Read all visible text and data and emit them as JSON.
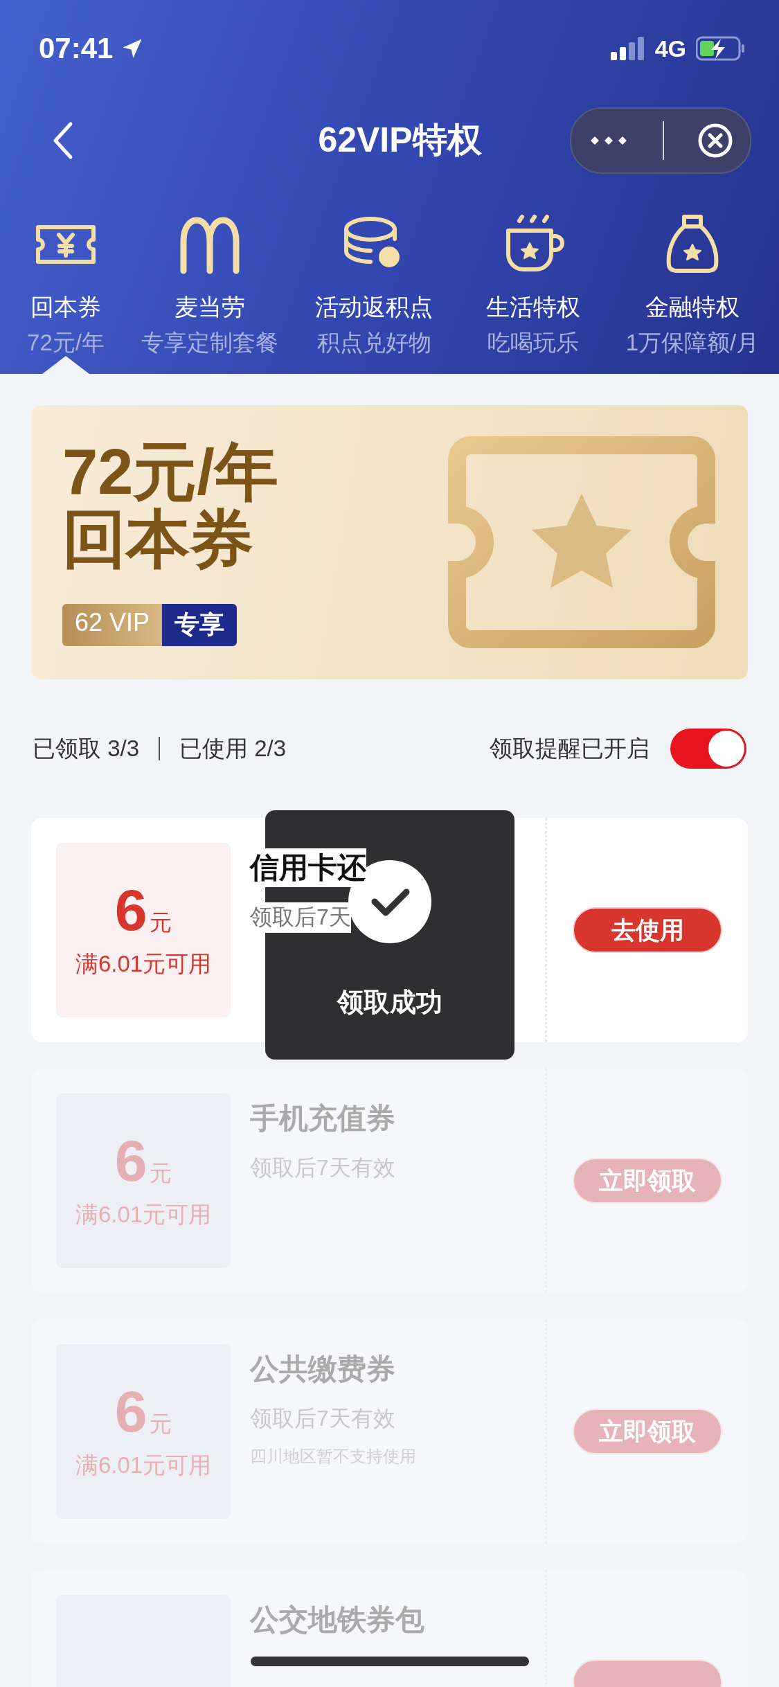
{
  "status_bar": {
    "time": "07:41",
    "network": "4G"
  },
  "nav": {
    "title": "62VIP特权"
  },
  "categories": [
    {
      "title": "回本券",
      "subtitle": "72元/年",
      "selected": true
    },
    {
      "title": "麦当劳",
      "subtitle": "专享定制套餐",
      "selected": false
    },
    {
      "title": "活动返积点",
      "subtitle": "积点兑好物",
      "selected": false
    },
    {
      "title": "生活特权",
      "subtitle": "吃喝玩乐",
      "selected": false
    },
    {
      "title": "金融特权",
      "subtitle": "1万保障额/月",
      "selected": false
    }
  ],
  "banner": {
    "price": "72元/年",
    "name": "回本券",
    "badge_left": "62 VIP",
    "badge_right": "专享"
  },
  "stats": {
    "claimed": "已领取 3/3",
    "used": "已使用 2/3",
    "reminder_label": "领取提醒已开启",
    "reminder_on": true
  },
  "coupons": [
    {
      "amount": "6",
      "unit": "元",
      "condition": "满6.01元可用",
      "title": "信用卡还",
      "validity": "领取后7天",
      "button": "去使用",
      "claimed": true
    },
    {
      "amount": "6",
      "unit": "元",
      "condition": "满6.01元可用",
      "title": "手机充值券",
      "validity": "领取后7天有效",
      "button": "立即领取",
      "claimed": false
    },
    {
      "amount": "6",
      "unit": "元",
      "condition": "满6.01元可用",
      "title": "公共缴费券",
      "validity": "领取后7天有效",
      "note": "四川地区暂不支持使用",
      "button": "立即领取",
      "claimed": false
    },
    {
      "title": "公交地铁券包",
      "claimed": false
    }
  ],
  "toast": {
    "text": "领取成功"
  }
}
